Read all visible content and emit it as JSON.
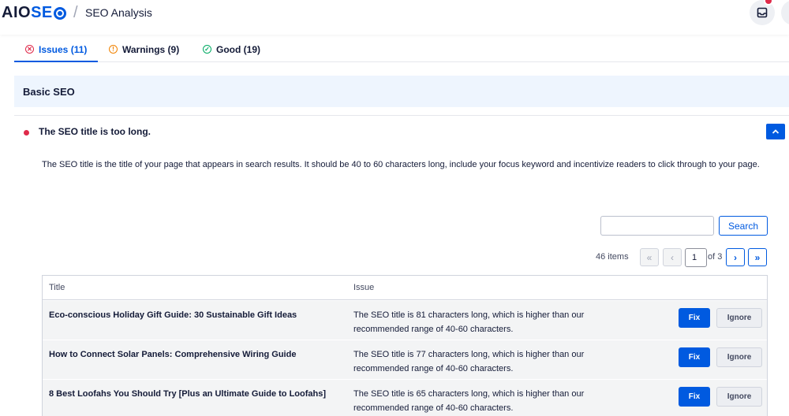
{
  "header": {
    "logo_prefix": "AIO",
    "logo_seo": "SE",
    "breadcrumb_sep": "/",
    "title": "SEO Analysis",
    "notification_badge": true
  },
  "tabs": [
    {
      "label": "Issues (11)",
      "icon": "x-circle-icon",
      "color": "#df2a4a",
      "active": true
    },
    {
      "label": "Warnings (9)",
      "icon": "alert-circle-icon",
      "color": "#f18200",
      "active": false
    },
    {
      "label": "Good (19)",
      "icon": "check-circle-icon",
      "color": "#00aa63",
      "active": false
    }
  ],
  "section": {
    "title": "Basic SEO"
  },
  "issue": {
    "title": "The SEO title is too long.",
    "description": "The SEO title is the title of your page that appears in search results. It should be 40 to 60 characters long, include your focus keyword and incentivize readers to click through to your page."
  },
  "search": {
    "value": "",
    "button_label": "Search"
  },
  "pagination": {
    "items_count": "46 items",
    "first": "«",
    "prev": "‹",
    "current_page": "1",
    "of_label": "of 3",
    "next": "›",
    "last": "»"
  },
  "table": {
    "columns": [
      "Title",
      "Issue"
    ],
    "rows": [
      {
        "title": "Eco-conscious Holiday Gift Guide: 30 Sustainable Gift Ideas",
        "issue": "The SEO title is 81 characters long, which is higher than our recommended range of 40-60 characters.",
        "fix": "Fix",
        "ignore": "Ignore"
      },
      {
        "title": "How to Connect Solar Panels: Comprehensive Wiring Guide",
        "issue": "The SEO title is 77 characters long, which is higher than our recommended range of 40-60 characters.",
        "fix": "Fix",
        "ignore": "Ignore"
      },
      {
        "title": "8 Best Loofahs You Should Try [Plus an Ultimate Guide to Loofahs]",
        "issue": "The SEO title is 65 characters long, which is higher than our recommended range of 40-60 characters.",
        "fix": "Fix",
        "ignore": "Ignore"
      }
    ]
  },
  "colors": {
    "accent": "#005ae0",
    "error": "#df2a4a",
    "warning": "#f18200",
    "good": "#00aa63"
  }
}
